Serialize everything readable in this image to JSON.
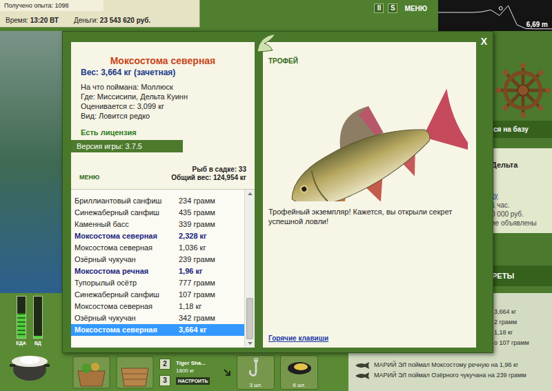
{
  "hud": {
    "experience": "Получено опыта: 1098",
    "time_label": "Время:",
    "time": "13:20 ВТ",
    "money_label": "Деньги:",
    "money": "23 543 620 руб."
  },
  "top_buttons": [
    "II",
    "S",
    "МЕНЮ"
  ],
  "depth_chart": {
    "reading": "6,69 m",
    "profile": [
      0.4,
      0.4,
      0.4,
      0.4,
      0.4,
      0.38,
      0.32,
      0.5,
      0.18,
      0.8,
      0.92,
      0.93,
      0.93,
      0.93
    ],
    "boat_level": 0.55
  },
  "side_panel": {
    "base_button": "ся на базу",
    "location": "Дельта",
    "link": "ку",
    "lines": [
      "1 час.",
      "0 000 руб.",
      "ие объявлены"
    ],
    "section": "РЕТЫ"
  },
  "feed": [
    {
      "text": "3,664 кг",
      "kind": "covered"
    },
    {
      "text": "2 грамм",
      "kind": "covered"
    },
    {
      "text": "1,18 кг",
      "kind": "covered"
    },
    {
      "text": "о 107 грамм",
      "kind": "covered"
    },
    {
      "text": "МАРИЙ ЭЛ поймал Моксостому речную на 1,96 кг",
      "kind": "full"
    },
    {
      "text": "МАРИЙ ЭЛ поймал Озёрного чукучана на 239 грамм",
      "kind": "full"
    }
  ],
  "toolbar": {
    "meters": [
      {
        "label": "ЕДА",
        "level": 0.6
      },
      {
        "label": "ВД",
        "level": 0.05
      }
    ],
    "hotkeys": [
      "2",
      "3"
    ],
    "reel": {
      "name": "Tiger Sha...",
      "capacity": "1800 кг",
      "button": "НАСТРОИТЬ"
    },
    "items": [
      {
        "count": "3 шт.",
        "kind": "hook"
      },
      {
        "count": "6 шт.",
        "kind": "mussel"
      }
    ]
  },
  "dialog": {
    "close": "X",
    "title": "Моксостома северная",
    "weight": "Вес: 3,664 кг (зачетная)",
    "details": [
      "На что поймана: Моллюск",
      "Где: Миссисипи, Дельта Куинн",
      "Оценивается с: 3,099 кг",
      "Вид: Ловится редко"
    ],
    "license": "Есть лицензия",
    "version": "Версия игры: 3.7.5",
    "menu": "МЕНЮ",
    "keepnet_count": "Рыб в садке: 33",
    "total_weight": "Общий вес: 124,954 кг",
    "scroll_level": 1,
    "catches": [
      {
        "name": "Бриллиантовый санфиш",
        "weight": "234 грамм",
        "trophy": false,
        "selected": false
      },
      {
        "name": "Синежаберный санфиш",
        "weight": "435 грамм",
        "trophy": false,
        "selected": false
      },
      {
        "name": "Каменный басс",
        "weight": "339 грамм",
        "trophy": false,
        "selected": false
      },
      {
        "name": "Моксостома северная",
        "weight": "2,328 кг",
        "trophy": true,
        "selected": false
      },
      {
        "name": "Моксостома северная",
        "weight": "1,036 кг",
        "trophy": false,
        "selected": false
      },
      {
        "name": "Озёрный чукучан",
        "weight": "239 грамм",
        "trophy": false,
        "selected": false
      },
      {
        "name": "Моксостома речная",
        "weight": "1,96 кг",
        "trophy": true,
        "selected": false
      },
      {
        "name": "Тупорылый осётр",
        "weight": "777 грамм",
        "trophy": false,
        "selected": false
      },
      {
        "name": "Синежаберный санфиш",
        "weight": "107 грамм",
        "trophy": false,
        "selected": false
      },
      {
        "name": "Моксостома северная",
        "weight": "1,18 кг",
        "trophy": false,
        "selected": false
      },
      {
        "name": "Озёрный чукучан",
        "weight": "342 грамм",
        "trophy": false,
        "selected": false
      },
      {
        "name": "Моксостома северная",
        "weight": "3,664 кг",
        "trophy": true,
        "selected": true
      }
    ],
    "trophy": {
      "heading": "ТРОФЕЙ",
      "message": "Трофейный экземпляр! Кажется, вы открыли секрет успешной ловли!",
      "hotkeys_link": "Горячие клавиши"
    }
  }
}
